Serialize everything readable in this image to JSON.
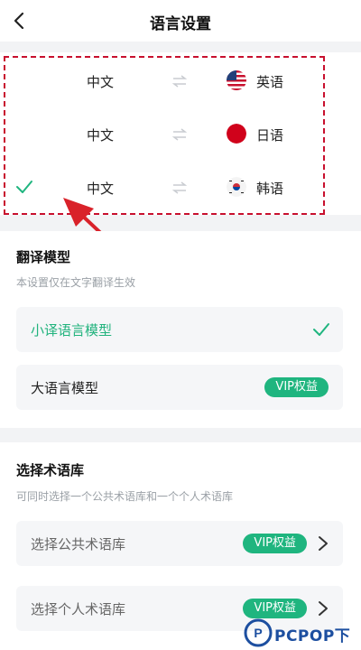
{
  "header": {
    "title": "语言设置"
  },
  "languages": [
    {
      "source": "中文",
      "target": "英语",
      "flag": "us-flag-icon",
      "selected": false
    },
    {
      "source": "中文",
      "target": "日语",
      "flag": "jp-flag-icon",
      "selected": false
    },
    {
      "source": "中文",
      "target": "韩语",
      "flag": "kr-flag-icon",
      "selected": true
    }
  ],
  "translation_model": {
    "title": "翻译模型",
    "description": "本设置仅在文字翻译生效",
    "options": [
      {
        "label": "小译语言模型",
        "selected": true
      },
      {
        "label": "大语言模型",
        "badge": "VIP权益"
      }
    ]
  },
  "glossary": {
    "title": "选择术语库",
    "description": "可同时选择一个公共术语库和一个个人术语库",
    "options": [
      {
        "label": "选择公共术语库",
        "badge": "VIP权益"
      },
      {
        "label": "选择个人术语库",
        "badge": "VIP权益"
      }
    ]
  },
  "watermark": {
    "text": "PCPOP下载"
  },
  "colors": {
    "accent": "#1fb57f",
    "highlight": "#c8102e",
    "arrow": "#d9222a"
  }
}
